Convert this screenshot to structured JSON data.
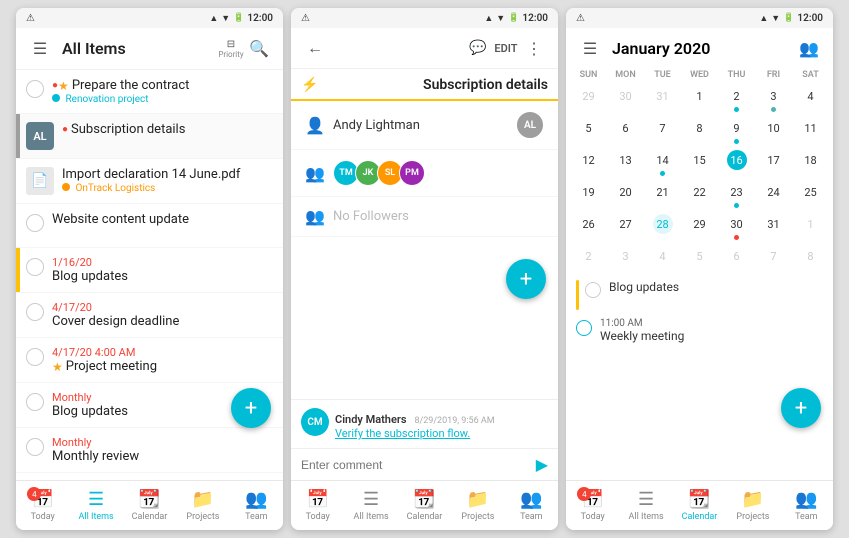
{
  "panel1": {
    "status_time": "12:00",
    "title": "All Items",
    "toolbar_label": "Priority",
    "items": [
      {
        "type": "task",
        "title": "Prepare the contract",
        "subtitle": "Renovation project",
        "subtitle_color": "#00bcd4",
        "dot_color": "#00bcd4",
        "has_priority": true,
        "has_star": true,
        "stripe": "none"
      },
      {
        "type": "group",
        "initials": "AL",
        "title": "Subscription details",
        "subtitle": "",
        "stripe": "gray"
      },
      {
        "type": "task",
        "title": "Import declaration 14 June.pdf",
        "subtitle": "OnTrack Logistics",
        "subtitle_color": "#ff9800",
        "has_file": true,
        "stripe": "none"
      },
      {
        "type": "task",
        "title": "Website content update",
        "subtitle": "",
        "stripe": "none",
        "has_checkbox": true
      },
      {
        "type": "dated",
        "date": "1/16/20",
        "title": "Blog updates",
        "stripe": "yellow"
      },
      {
        "type": "dated",
        "date": "4/17/20",
        "title": "Cover design deadline",
        "stripe": "none"
      },
      {
        "type": "dated",
        "date": "4/17/20 4:00 AM",
        "title": "Project meeting",
        "has_star": true,
        "stripe": "none"
      },
      {
        "type": "dated",
        "date": "Monthly",
        "title": "Blog updates",
        "stripe": "none"
      },
      {
        "type": "dated",
        "date": "Monthly",
        "title": "Monthly review",
        "stripe": "none"
      }
    ],
    "nav": [
      {
        "label": "Today",
        "icon": "📅",
        "active": false,
        "badge": 4
      },
      {
        "label": "All Items",
        "icon": "☰",
        "active": true,
        "badge": 0
      },
      {
        "label": "Calendar",
        "icon": "📆",
        "active": false,
        "badge": 0
      },
      {
        "label": "Projects",
        "icon": "📁",
        "active": false,
        "badge": 0
      },
      {
        "label": "Team",
        "icon": "👥",
        "active": false,
        "badge": 0
      }
    ]
  },
  "panel2": {
    "status_time": "12:00",
    "title": "Subscription details",
    "edit_label": "EDIT",
    "assignee": "Andy Lightman",
    "followers_label": "No Followers",
    "comment_author": "Cindy Mathers",
    "comment_date": "8/29/2019, 9:56 AM",
    "comment_text": "Verify the subscription flow.",
    "comment_placeholder": "Enter comment",
    "nav": [
      {
        "label": "Today",
        "icon": "📅",
        "active": false
      },
      {
        "label": "All Items",
        "icon": "☰",
        "active": false
      },
      {
        "label": "Calendar",
        "icon": "📆",
        "active": false
      },
      {
        "label": "Projects",
        "icon": "📁",
        "active": false
      },
      {
        "label": "Team",
        "icon": "👥",
        "active": false
      }
    ]
  },
  "panel3": {
    "status_time": "12:00",
    "title": "January 2020",
    "day_names": [
      "SUN",
      "MON",
      "TUE",
      "WED",
      "THU",
      "FRI",
      "SAT"
    ],
    "weeks": [
      [
        {
          "d": "29",
          "om": true
        },
        {
          "d": "30",
          "om": true
        },
        {
          "d": "31",
          "om": true
        },
        {
          "d": "1"
        },
        {
          "d": "2",
          "dot": "blue"
        },
        {
          "d": "3",
          "dot": "teal"
        },
        {
          "d": "4"
        }
      ],
      [
        {
          "d": "5"
        },
        {
          "d": "6"
        },
        {
          "d": "7"
        },
        {
          "d": "8"
        },
        {
          "d": "9",
          "dot": "blue"
        },
        {
          "d": "10"
        },
        {
          "d": "11"
        }
      ],
      [
        {
          "d": "12"
        },
        {
          "d": "13"
        },
        {
          "d": "14",
          "dot": "blue"
        },
        {
          "d": "15"
        },
        {
          "d": "16",
          "today": true
        },
        {
          "d": "17"
        },
        {
          "d": "18"
        }
      ],
      [
        {
          "d": "19"
        },
        {
          "d": "20"
        },
        {
          "d": "21"
        },
        {
          "d": "22"
        },
        {
          "d": "23",
          "dot": "blue"
        },
        {
          "d": "24"
        },
        {
          "d": "25"
        }
      ],
      [
        {
          "d": "26"
        },
        {
          "d": "27"
        },
        {
          "d": "28",
          "selected": true
        },
        {
          "d": "29"
        },
        {
          "d": "30",
          "dot": "red"
        },
        {
          "d": "31"
        },
        {
          "d": "1",
          "om": true
        }
      ],
      [
        {
          "d": "2",
          "om": true
        },
        {
          "d": "3",
          "om": true
        },
        {
          "d": "4",
          "om": true
        },
        {
          "d": "5",
          "om": true
        },
        {
          "d": "6",
          "om": true
        },
        {
          "d": "7",
          "om": true
        },
        {
          "d": "8",
          "om": true
        }
      ]
    ],
    "events": [
      {
        "type": "task",
        "title": "Blog updates"
      },
      {
        "type": "timed",
        "time": "11:00 AM",
        "title": "Weekly meeting"
      }
    ],
    "nav": [
      {
        "label": "Today",
        "icon": "📅",
        "active": false,
        "badge": 4
      },
      {
        "label": "All Items",
        "icon": "☰",
        "active": false,
        "badge": 0
      },
      {
        "label": "Calendar",
        "icon": "📆",
        "active": true,
        "badge": 0
      },
      {
        "label": "Projects",
        "icon": "📁",
        "active": false,
        "badge": 0
      },
      {
        "label": "Team",
        "icon": "👥",
        "active": false,
        "badge": 0
      }
    ]
  }
}
